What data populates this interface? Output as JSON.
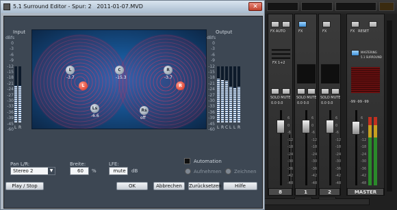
{
  "window": {
    "title": "5.1 Surround Editor - Spur: 2",
    "filename": "2011-01-07.MVD",
    "close_glyph": "✕"
  },
  "input": {
    "label": "Input",
    "unit": "dBfs",
    "scale": [
      "0",
      "-3",
      "-6",
      "-9",
      "-12",
      "-15",
      "-18",
      "-21",
      "-24",
      "-27",
      "-30",
      "-33",
      "-36",
      "-39",
      "-45",
      "-60"
    ],
    "channels": [
      {
        "name": "L",
        "level": 0.66
      },
      {
        "name": "R",
        "level": 0.66
      }
    ]
  },
  "output": {
    "label": "Output",
    "unit": "dBfs",
    "scale": [
      "0",
      "-3",
      "-6",
      "-9",
      "-12",
      "-15",
      "-18",
      "-21",
      "-24",
      "-27",
      "-30",
      "-33",
      "-36",
      "-39",
      "-45",
      "-60"
    ],
    "channels": [
      {
        "name": "L",
        "level": 0.78
      },
      {
        "name": "R",
        "level": 0.76
      },
      {
        "name": "C",
        "level": 0.74
      },
      {
        "name": "L",
        "level": 0.64
      },
      {
        "name": "L",
        "level": 0.62
      },
      {
        "name": "R",
        "level": 0.64
      }
    ]
  },
  "speakers": [
    {
      "id": "L",
      "value": "-3.7",
      "selected": false
    },
    {
      "id": "L",
      "value": "",
      "selected": true
    },
    {
      "id": "C",
      "value": "-15.3",
      "selected": false
    },
    {
      "id": "Ls",
      "value": "-6.6",
      "selected": false
    },
    {
      "id": "Rs",
      "value": "off",
      "selected": false
    },
    {
      "id": "R",
      "value": "-3.7",
      "selected": false
    },
    {
      "id": "R",
      "value": "",
      "selected": true
    }
  ],
  "controls": {
    "pan_label": "Pan L/R:",
    "pan_value": "Stereo 2",
    "width_label": "Breite:",
    "width_value": "60",
    "width_unit": "%",
    "lfe_label": "LFE:",
    "lfe_value": "mute",
    "lfe_unit": "dB",
    "automation_label": "Automation",
    "record_label": "Aufnehmen",
    "draw_label": "Zeichnen"
  },
  "buttons": {
    "play_stop": "Play / Stop",
    "ok": "OK",
    "cancel": "Abbrechen",
    "reset": "Zurücksetzen",
    "help": "Hilfe"
  },
  "mixer": {
    "strips": [
      {
        "name": "8",
        "top1": "FX",
        "top2": "AUTO",
        "solo": "SOLO",
        "mute": "MUTE",
        "extra": "FX 1+2",
        "vals": "0.0  0.0"
      },
      {
        "name": "1",
        "top1": "FX",
        "top2": "",
        "solo": "SOLO",
        "mute": "MUTE",
        "extra": "",
        "vals": "0.0  0.0"
      },
      {
        "name": "2",
        "top1": "FX",
        "top2": "",
        "solo": "SOLO",
        "mute": "MUTE",
        "extra": "",
        "vals": "0.0  0.0"
      }
    ],
    "fx_label_1": "FX",
    "fx_label_2": "FX",
    "master": {
      "name": "MASTER",
      "fx": "FX",
      "reset": "RESET",
      "mastering": "MASTERING",
      "surround": "5.1 SURROUND",
      "vals": "-99  -99  -99"
    },
    "scale": [
      "6",
      "0",
      "-6",
      "-12",
      "-18",
      "-24",
      "-30",
      "-36",
      "-42",
      "-48"
    ]
  }
}
